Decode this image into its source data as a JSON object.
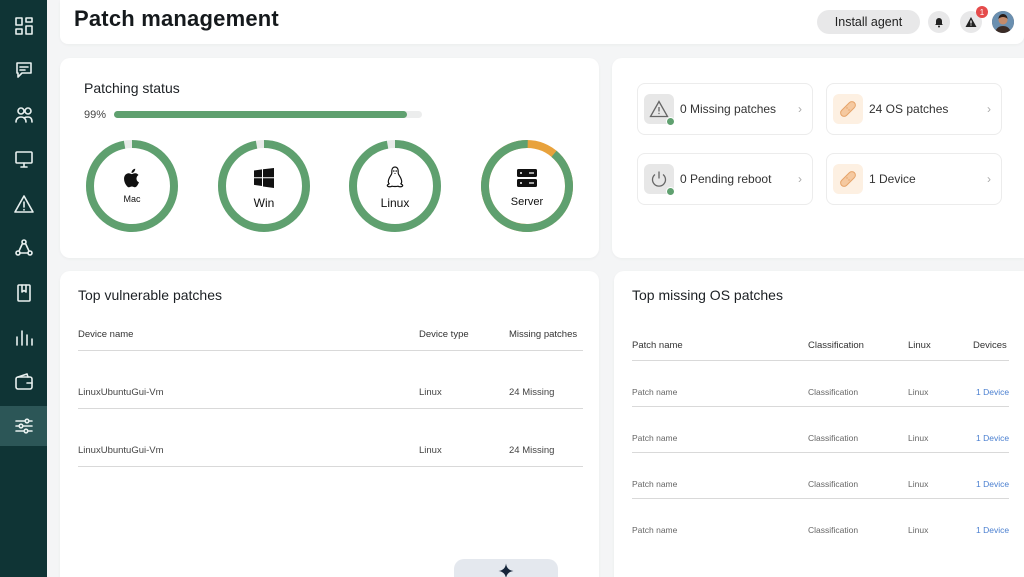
{
  "sidebar": {
    "items": [
      {
        "icon": "dashboard-icon"
      },
      {
        "icon": "chat-icon"
      },
      {
        "icon": "users-icon"
      },
      {
        "icon": "monitor-icon"
      },
      {
        "icon": "alert-icon"
      },
      {
        "icon": "network-icon"
      },
      {
        "icon": "book-icon"
      },
      {
        "icon": "chart-icon"
      },
      {
        "icon": "wallet-icon"
      },
      {
        "icon": "sliders-icon",
        "active": true
      }
    ]
  },
  "header": {
    "title": "Patch management",
    "install_label": "Install agent",
    "alert_badge": "1"
  },
  "patching_status": {
    "title": "Patching status",
    "percent_label": "99%",
    "progress": 0.95,
    "rings": [
      {
        "label": "Mac",
        "icon": "apple-icon",
        "completion": 0.97
      },
      {
        "label": "Win",
        "icon": "windows-icon",
        "completion": 0.97
      },
      {
        "label": "Linux",
        "icon": "linux-icon",
        "completion": 0.97
      },
      {
        "label": "Server",
        "icon": "server-icon",
        "completion": 0.89
      }
    ]
  },
  "summary": {
    "tiles": [
      {
        "text": "0 Missing  patches",
        "icon": "warning-icon"
      },
      {
        "text": "24 OS patches",
        "icon": "bandage-icon"
      },
      {
        "text": "0 Pending reboot",
        "icon": "power-icon"
      },
      {
        "text": "1 Device",
        "icon": "bandage-icon"
      }
    ],
    "chevron": "›"
  },
  "vulnerable": {
    "title": "Top vulnerable patches",
    "columns": [
      "Device name",
      "Device type",
      "Missing patches"
    ],
    "rows": [
      [
        "LinuxUbuntuGui-Vm",
        "Linux",
        "24 Missing"
      ],
      [
        "LinuxUbuntuGui-Vm",
        "Linux",
        "24 Missing"
      ]
    ]
  },
  "missing_os": {
    "title": "Top missing OS patches",
    "columns": [
      "Patch name",
      "Classification",
      "Linux",
      "Devices"
    ],
    "rows": [
      [
        "Patch name",
        "Classification",
        "Linux",
        "1 Device"
      ],
      [
        "Patch name",
        "Classification",
        "Linux",
        "1 Device"
      ],
      [
        "Patch name",
        "Classification",
        "Linux",
        "1 Device"
      ],
      [
        "Patch name",
        "Classification",
        "Linux",
        "1 Device"
      ]
    ]
  },
  "colors": {
    "sidebar_bg": "#0f3435",
    "progress_green": "#5fa06f",
    "server_orange": "#e8a23c",
    "link_blue": "#4a7fd0"
  }
}
